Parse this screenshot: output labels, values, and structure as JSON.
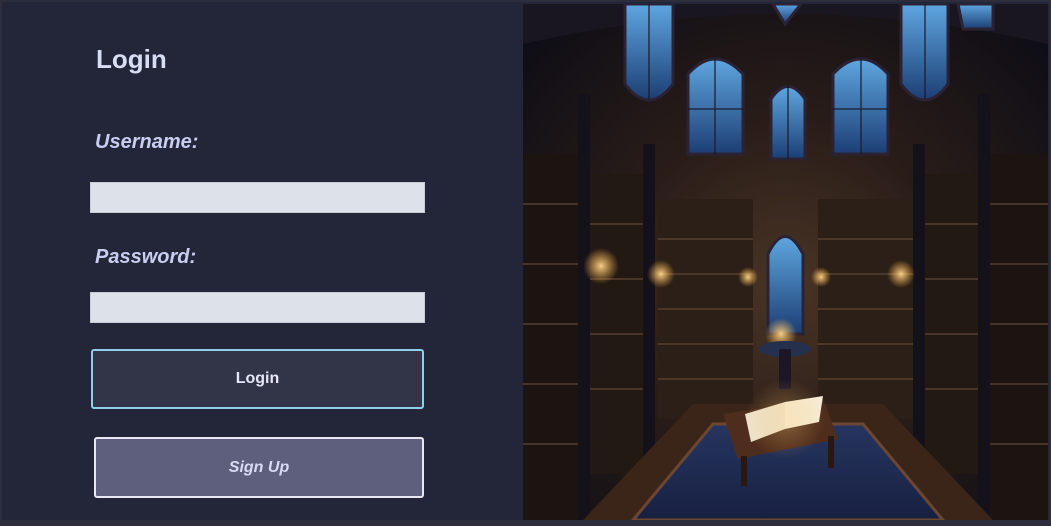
{
  "login_form": {
    "title": "Login",
    "username_label": "Username:",
    "username_value": "",
    "password_label": "Password:",
    "password_value": "",
    "login_button": "Login",
    "signup_button": "Sign Up"
  },
  "illustration": {
    "subject": "library-interior-illustration"
  },
  "colors": {
    "panel_bg": "#232538",
    "text": "#d8dcf5",
    "input_bg": "#dde1ea",
    "login_btn_bg": "#323548",
    "login_btn_border": "#8fd0e8",
    "signup_btn_bg": "#5d5f7c"
  }
}
